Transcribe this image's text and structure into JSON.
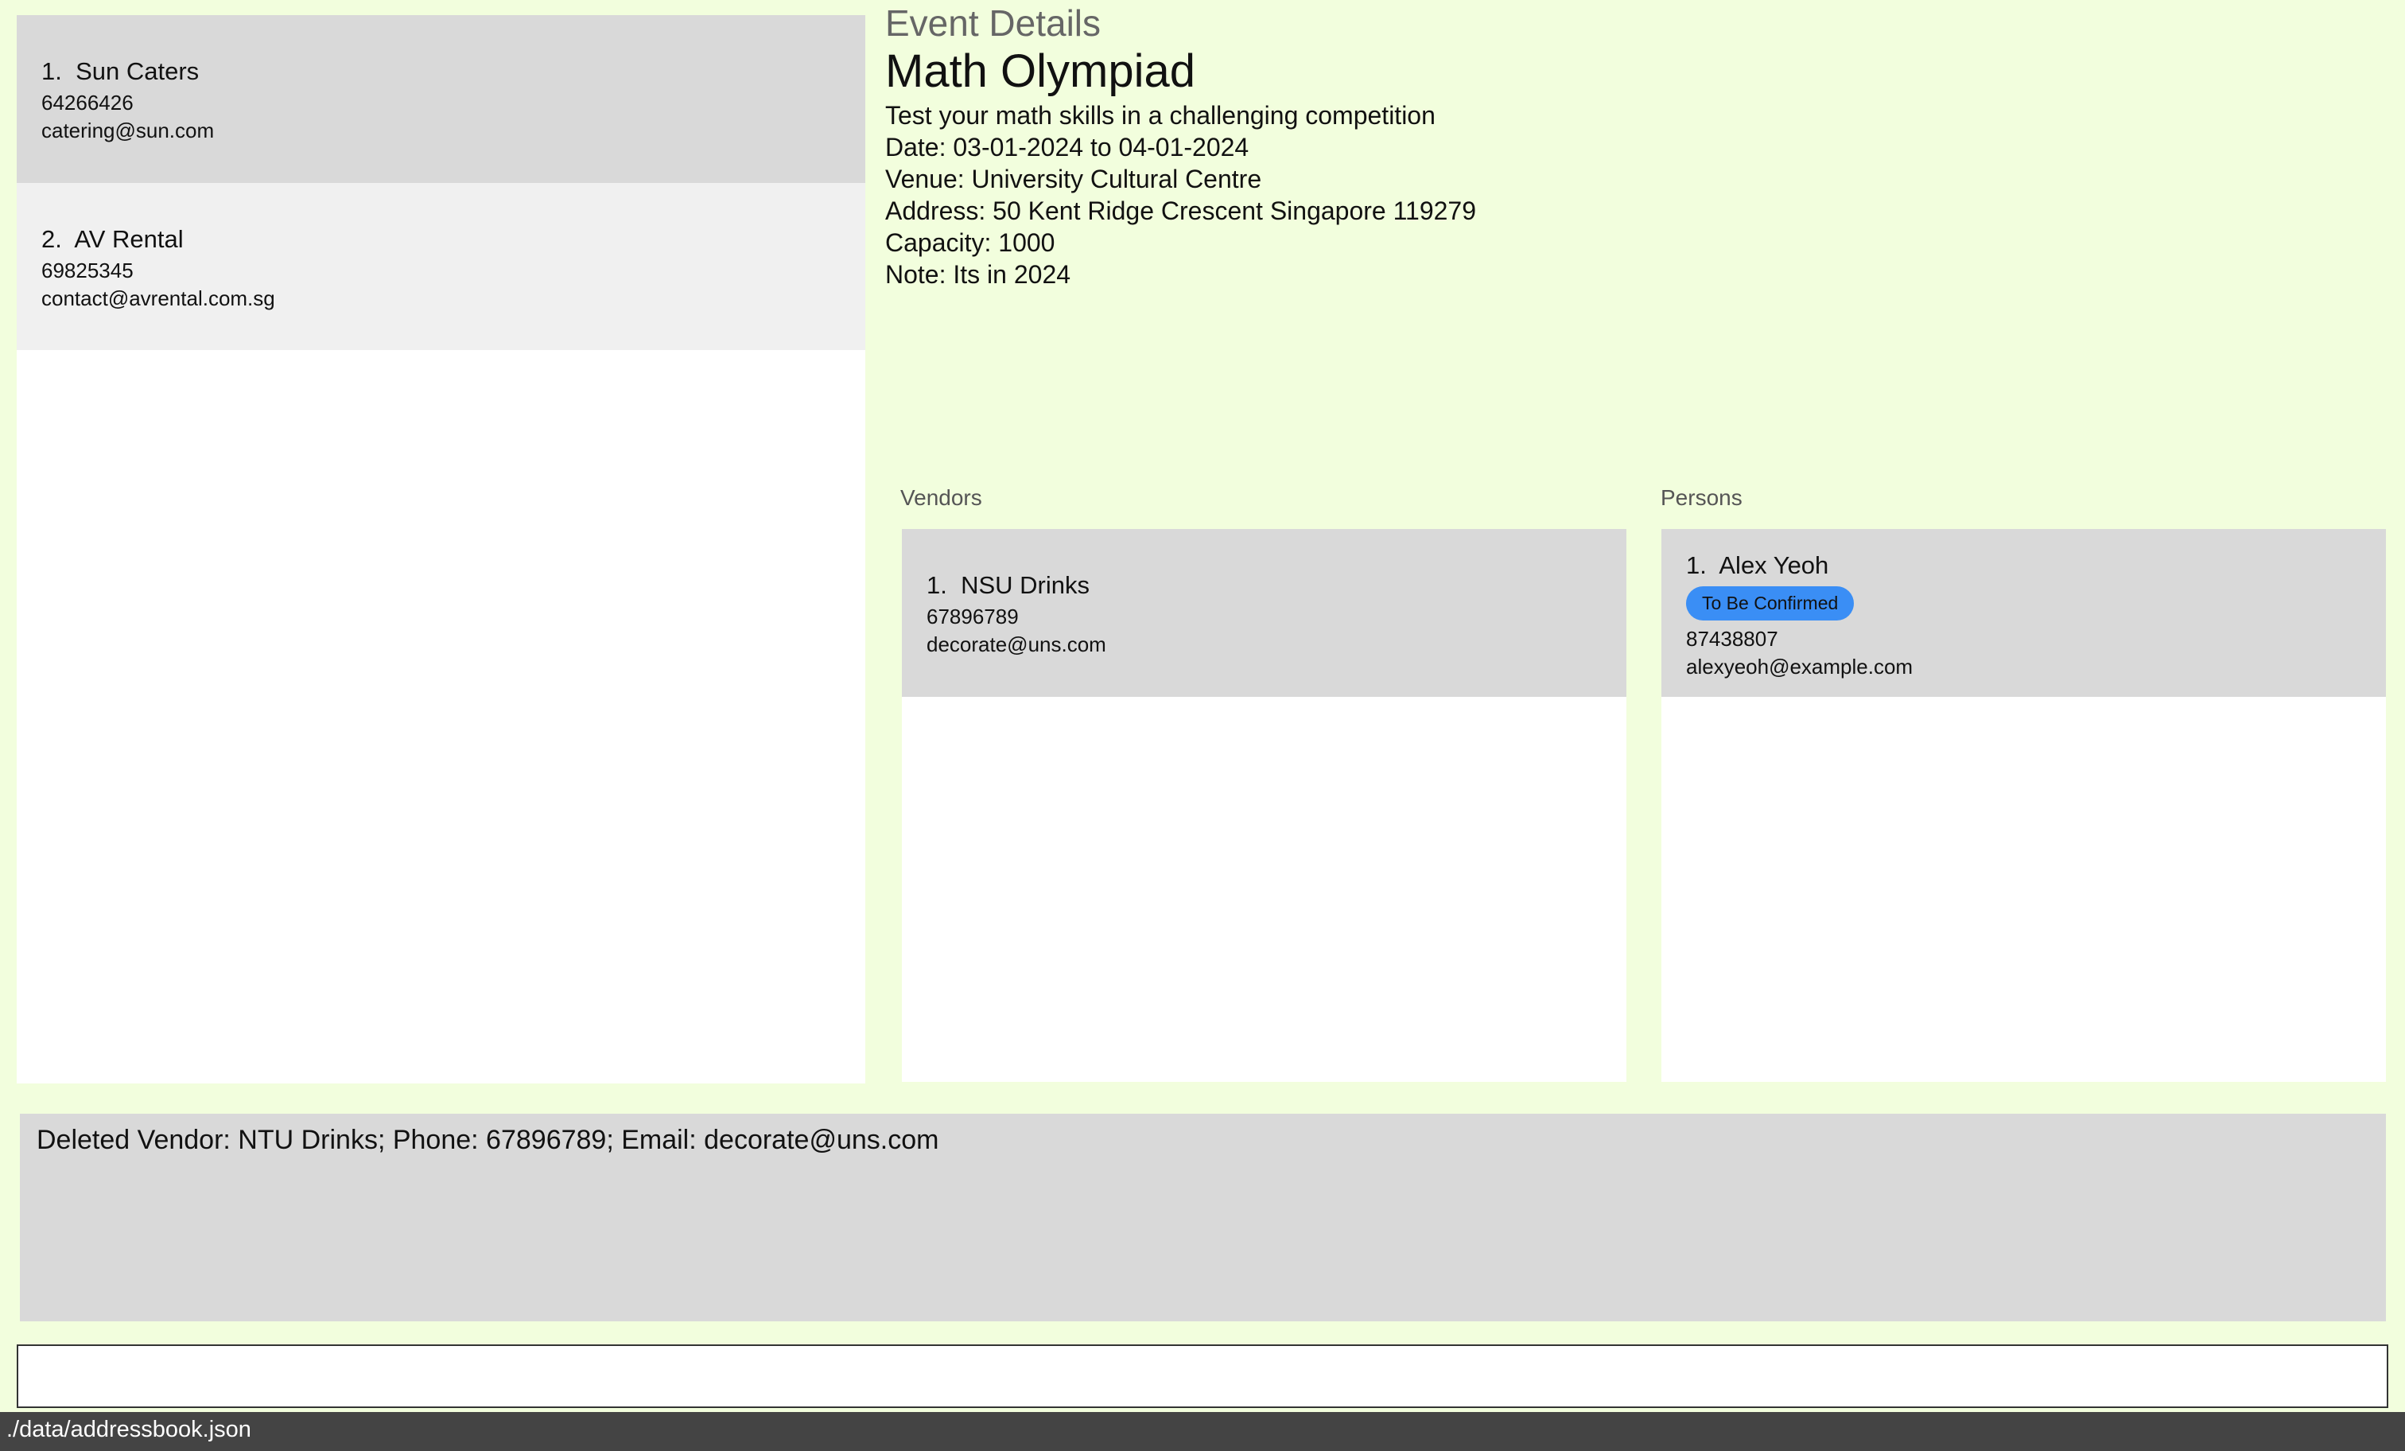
{
  "vendor_list": [
    {
      "index": "1.",
      "name": "Sun Caters",
      "phone": "64266426",
      "email": "catering@sun.com"
    },
    {
      "index": "2.",
      "name": "AV Rental",
      "phone": "69825345",
      "email": "contact@avrental.com.sg"
    }
  ],
  "event": {
    "header": "Event Details",
    "name": "Math Olympiad",
    "description": "Test your math skills in a challenging competition",
    "date": "Date: 03-01-2024 to 04-01-2024",
    "venue": "Venue: University Cultural Centre",
    "address": "Address: 50 Kent Ridge Crescent Singapore 119279",
    "capacity": "Capacity: 1000",
    "note": "Note: Its in 2024"
  },
  "vendors": {
    "label": "Vendors",
    "items": [
      {
        "index": "1.",
        "name": "NSU Drinks",
        "phone": "67896789",
        "email": "decorate@uns.com"
      }
    ]
  },
  "persons": {
    "label": "Persons",
    "items": [
      {
        "index": "1.",
        "name": "Alex Yeoh",
        "tag": "To Be Confirmed",
        "phone": "87438807",
        "email": "alexyeoh@example.com"
      }
    ]
  },
  "result": "Deleted Vendor: NTU Drinks; Phone: 67896789; Email: decorate@uns.com",
  "command": {
    "value": ""
  },
  "status": "./data/addressbook.json",
  "colors": {
    "background": "#f2fedd",
    "card_selected": "#d9d9d9",
    "card_alt": "#f0f0f0",
    "badge": "#3a8ef5",
    "status_bar": "#444444"
  }
}
